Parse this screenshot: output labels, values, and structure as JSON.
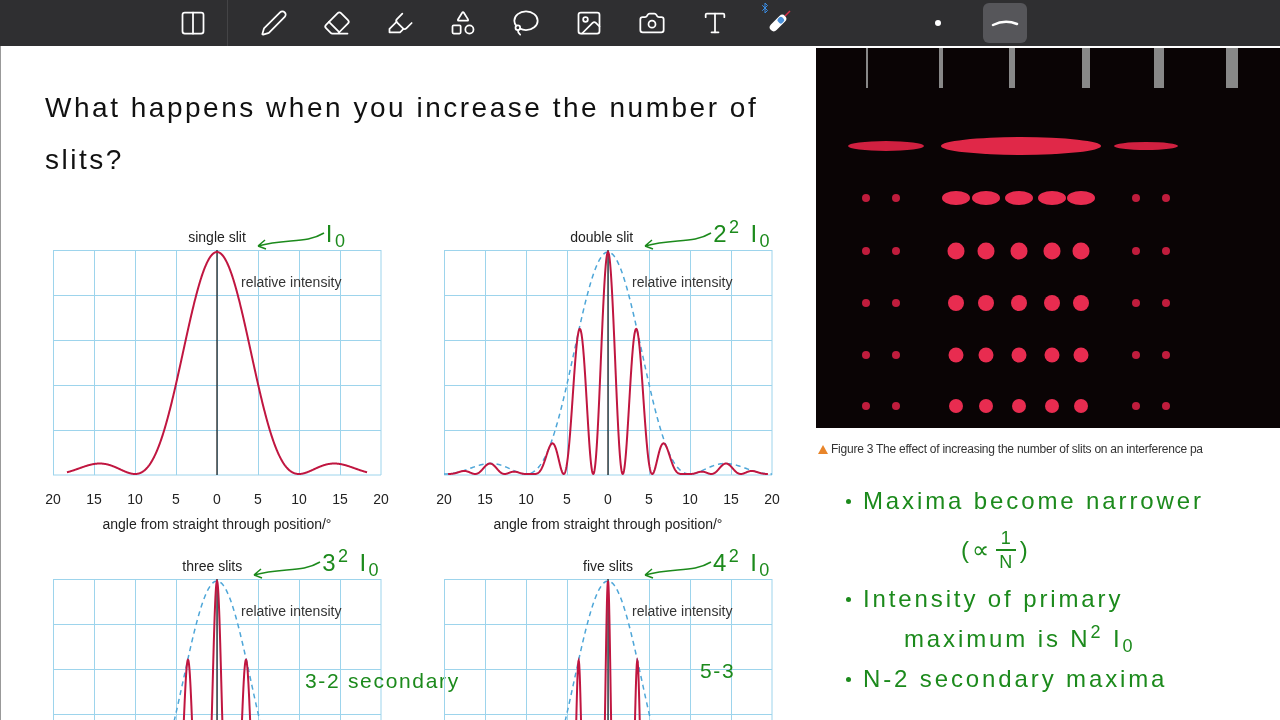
{
  "toolbar": {
    "tools": [
      {
        "kind": "page",
        "selected": false
      },
      {
        "kind": "pen",
        "selected": false
      },
      {
        "kind": "eraser",
        "selected": false
      },
      {
        "kind": "highlighter",
        "selected": false
      },
      {
        "kind": "shapes",
        "selected": false
      },
      {
        "kind": "lasso",
        "selected": false
      },
      {
        "kind": "image",
        "selected": false
      },
      {
        "kind": "camera",
        "selected": false
      },
      {
        "kind": "textbox",
        "selected": false
      },
      {
        "kind": "stylus",
        "selected": false
      },
      {
        "kind": "dot",
        "selected": false
      },
      {
        "kind": "stroke",
        "selected": true
      }
    ]
  },
  "question": "What happens when you increase the number of slits?",
  "charts": [
    {
      "kind": "single",
      "title": "single slit",
      "axis_label": "relative intensity",
      "annotation": "I$_{0}$",
      "xticks": [
        "20",
        "15",
        "10",
        "5",
        "0",
        "5",
        "10",
        "15",
        "20"
      ],
      "xlabel": "angle from straight through position/°"
    },
    {
      "kind": "double",
      "title": "double slit",
      "axis_label": "relative intensity",
      "annotation": "2$^{2}$ I$_{0}$",
      "xticks": [
        "20",
        "15",
        "10",
        "5",
        "0",
        "5",
        "10",
        "15",
        "20"
      ],
      "xlabel": "angle from straight through position/°"
    },
    {
      "kind": "triple",
      "title": "three slits",
      "axis_label": "relative intensity",
      "annotation": "3$^{2}$ I$_{0}$",
      "note": "3-2 secondary"
    },
    {
      "kind": "quintuple",
      "title": "five slits",
      "axis_label": "relative intensity",
      "annotation": "4$^{2}$ I$_{0}$",
      "note": "5-3"
    }
  ],
  "figure": {
    "caption": "Figure 3 The effect of increasing the number of slits on an interference pa"
  },
  "notes": [
    {
      "kind": "bullet",
      "text": "Maxima become narrower"
    },
    {
      "kind": "fraction",
      "prefix": "(∝",
      "numerator": "1",
      "denominator": "N",
      "suffix": ")"
    },
    {
      "kind": "bullet",
      "text": "Intensity of primary"
    },
    {
      "kind": "continuation",
      "text": "maximum is N$^{2}$ I$_{0}$"
    },
    {
      "kind": "bullet",
      "text": "N-2 secondary maxima"
    }
  ]
}
